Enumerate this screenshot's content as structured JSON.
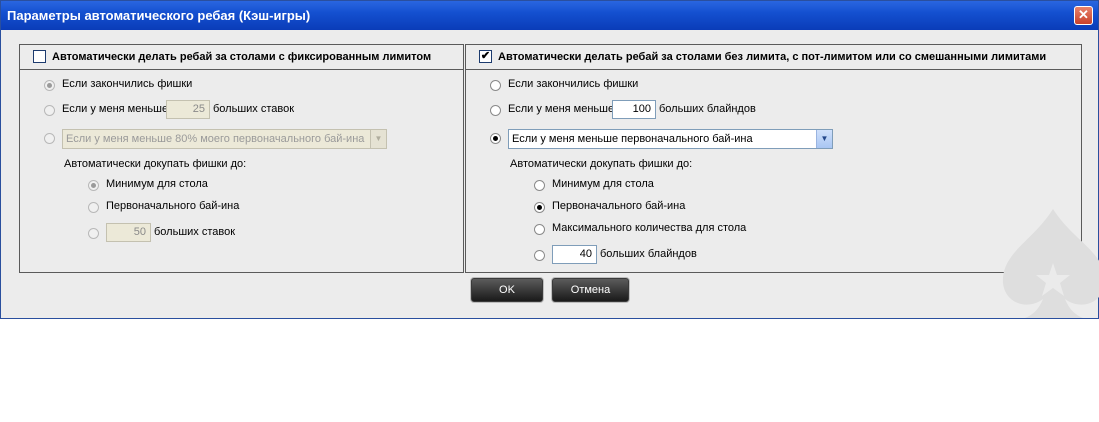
{
  "window": {
    "title": "Параметры автоматического ребая (Кэш-игры)",
    "close_glyph": "✕"
  },
  "left_panel": {
    "enabled": false,
    "header": "Автоматически делать ребай за столами с фиксированным лимитом",
    "options": {
      "out_of_chips": "Если закончились фишки",
      "less_than_prefix": "Если у меня меньше",
      "less_than_value": "25",
      "less_than_suffix": "больших ставок",
      "dropdown_value": "Если у меня меньше 80% моего первоначального бай-ина"
    },
    "topup_label": "Автоматически докупать фишки до:",
    "topup": {
      "table_min": "Минимум для стола",
      "initial_buyin": "Первоначального бай-ина",
      "custom_value": "50",
      "custom_suffix": "больших ставок"
    },
    "selected_option": "out_of_chips",
    "selected_topup": "table_min"
  },
  "right_panel": {
    "enabled": true,
    "header": "Автоматически делать ребай за столами без лимита, с пот-лимитом или со смешанными лимитами",
    "options": {
      "out_of_chips": "Если закончились фишки",
      "less_than_prefix": "Если у меня меньше",
      "less_than_value": "100",
      "less_than_suffix": "больших блайндов",
      "dropdown_value": "Если у меня меньше первоначального бай-ина"
    },
    "topup_label": "Автоматически докупать фишки до:",
    "topup": {
      "table_min": "Минимум для стола",
      "initial_buyin": "Первоначального бай-ина",
      "table_max": "Максимального количества для стола",
      "custom_value": "40",
      "custom_suffix": "больших блайндов"
    },
    "selected_option": "dropdown",
    "selected_topup": "initial_buyin"
  },
  "buttons": {
    "ok": "OK",
    "cancel": "Отмена"
  },
  "icons": {
    "checkbox_check": "✔",
    "dropdown_arrow": "▼"
  }
}
